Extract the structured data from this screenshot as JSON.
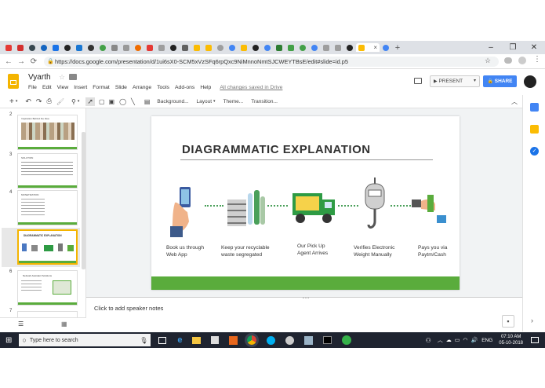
{
  "browser": {
    "active_tab_title": "",
    "url": "https://docs.google.com/presentation/d/1ui6sX0-SCM5xVzSFq6rpQxc9NiMnnoNmtSJCWEYTBsE/edit#slide=id.p5"
  },
  "docs": {
    "title": "Vyarth",
    "menu": [
      "File",
      "Edit",
      "View",
      "Insert",
      "Format",
      "Slide",
      "Arrange",
      "Tools",
      "Add-ons",
      "Help"
    ],
    "save_status": "All changes saved in Drive",
    "present_label": "PRESENT",
    "share_label": "SHARE"
  },
  "toolbar": {
    "background_label": "Background...",
    "layout_label": "Layout",
    "theme_label": "Theme...",
    "transition_label": "Transition..."
  },
  "filmstrip": {
    "slides": [
      {
        "number": "2",
        "title": "Inspiration Behind the Idea"
      },
      {
        "number": "3",
        "title": "SOLUTION"
      },
      {
        "number": "4",
        "title": "MONETIZATION"
      },
      {
        "number": "5",
        "title": "DIAGRAMMATIC EXPLANATION"
      },
      {
        "number": "6",
        "title": "Network Assistant Solutions"
      },
      {
        "number": "7",
        "title": ""
      }
    ]
  },
  "slide": {
    "title": "DIAGRAMMATIC  EXPLANATION",
    "steps": [
      {
        "line1": "Book us through",
        "line2": "Web App"
      },
      {
        "line1": "Keep your recyclable",
        "line2": "waste segregated"
      },
      {
        "line1": "Our Pick Up",
        "line2": "Agent Arrives"
      },
      {
        "line1": "Verifies Electronic",
        "line2": "Weight Manually"
      },
      {
        "line1": "Pays you via",
        "line2": "Paytm/Cash"
      }
    ],
    "accent_color": "#5aac3c"
  },
  "notes": {
    "placeholder": "Click to add speaker notes"
  },
  "taskbar": {
    "search_placeholder": "Type here to search",
    "language": "ENG",
    "time": "07:10 AM",
    "date": "05-10-2018"
  }
}
